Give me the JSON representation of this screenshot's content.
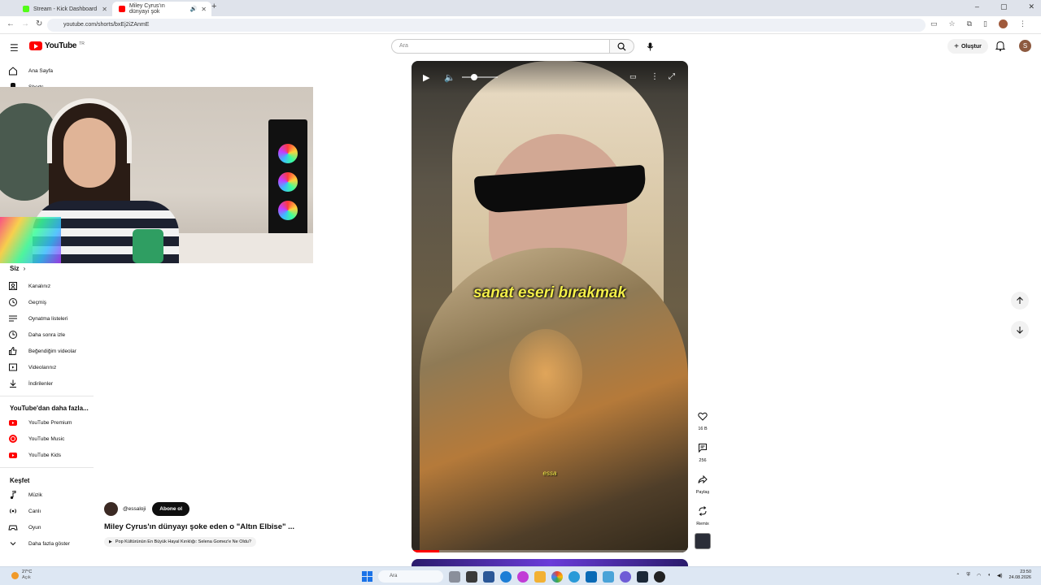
{
  "browser": {
    "tabs": [
      {
        "title": "Stream - Kick Dashboard",
        "favicon_color": "#53fc18"
      },
      {
        "title": "Miley Cyrus'ın dünyayı şok",
        "favicon_color": "#ff0000"
      }
    ],
    "new_tab": "+",
    "url": "youtube.com/shorts/bxEj2iZAnmE",
    "window_controls": [
      "–",
      "▢",
      "✕"
    ]
  },
  "header": {
    "logo_text": "YouTube",
    "logo_region": "TR",
    "search_placeholder": "Ara",
    "create_label": "Oluştur",
    "avatar_letter": "S"
  },
  "sidebar": {
    "top_items": [
      {
        "label": "Ana Sayfa",
        "icon": "home-icon"
      },
      {
        "label": "Shorts",
        "icon": "shorts-icon"
      }
    ],
    "you_heading": "Siz",
    "you_items": [
      {
        "label": "Kanalınız",
        "icon": "channel-icon"
      },
      {
        "label": "Geçmiş",
        "icon": "history-icon"
      },
      {
        "label": "Oynatma listeleri",
        "icon": "playlist-icon"
      },
      {
        "label": "Daha sonra izle",
        "icon": "clock-icon"
      },
      {
        "label": "Beğendiğim videolar",
        "icon": "thumbs-up-icon"
      },
      {
        "label": "Videolarınız",
        "icon": "video-icon"
      },
      {
        "label": "İndirilenler",
        "icon": "download-icon"
      }
    ],
    "more_heading": "YouTube'dan daha fazla...",
    "more_items": [
      {
        "label": "YouTube Premium",
        "icon": "yt-premium-icon"
      },
      {
        "label": "YouTube Music",
        "icon": "yt-music-icon"
      },
      {
        "label": "YouTube Kids",
        "icon": "yt-kids-icon"
      }
    ],
    "explore_heading": "Keşfet",
    "explore_items": [
      {
        "label": "Müzik",
        "icon": "music-icon"
      },
      {
        "label": "Canlı",
        "icon": "live-icon"
      },
      {
        "label": "Oyun",
        "icon": "gaming-icon"
      },
      {
        "label": "Daha fazla göster",
        "icon": "chevron-down-icon"
      }
    ]
  },
  "short": {
    "channel": "@essaloji",
    "subscribe_label": "Abone ol",
    "title": "Miley Cyrus'ın dünyayı şoke eden o \"Altın Elbise\" ...",
    "chip": "Pop Kültürünün En Büyük Hayal Kırıklığı: Selena Gomez'e Ne Oldu?",
    "caption": "sanat eseri bırakmak",
    "watermark": "essa",
    "progress_fraction": 0.1,
    "actions": {
      "like_count": "16 B",
      "comment_count": "256",
      "share_label": "Paylaş",
      "remix_label": "Remix"
    }
  },
  "taskbar": {
    "weather_temp": "27°C",
    "weather_desc": "Açık",
    "search_placeholder": "Ara",
    "time": "23:50",
    "date": "24.08.2026"
  },
  "colors": {
    "youtube_red": "#ff0000",
    "caption_yellow": "#f4ef49",
    "taskbar_bg": "#dde7f3"
  }
}
